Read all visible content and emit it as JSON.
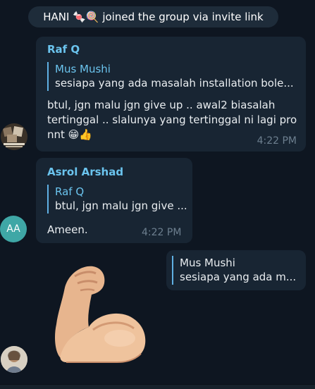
{
  "service": {
    "text": "HANI 🍬🍭 joined the group via invite link"
  },
  "messages": [
    {
      "sender": "Raf Q",
      "reply_name": "Mus Mushi",
      "reply_text": "sesiapa  yang ada masalah installation bole...",
      "text": "btul, jgn malu jgn give up .. awal2 biasalah\ntertinggal .. slalunya yang tertinggal ni lagi pro\nnnt 😁👍",
      "time": "4:22 PM"
    },
    {
      "sender": "Asrol Arshad",
      "avatar_initials": "AA",
      "reply_name": "Raf Q",
      "reply_text": "btul, jgn malu jgn give ...",
      "text": "Ameen.",
      "time": "4:22 PM"
    },
    {
      "reply_name": "Mus Mushi",
      "reply_text": "sesiapa  yang ada m...",
      "sticker": "flexed-biceps"
    }
  ],
  "colors": {
    "background": "#0e1621",
    "bubble": "#182533",
    "accent": "#6bc4ee",
    "avatar_aa": "#3fa7a6"
  }
}
